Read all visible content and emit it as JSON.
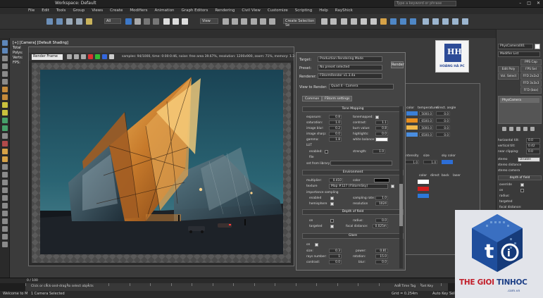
{
  "title_bar": {
    "workspace": "Workspace: Default",
    "search_placeholder": "Type a keyword or phrase"
  },
  "menu": [
    "File",
    "Edit",
    "Tools",
    "Group",
    "Views",
    "Create",
    "Modifiers",
    "Animation",
    "Graph Editors",
    "Rendering",
    "Civil View",
    "Customize",
    "Scripting",
    "Help",
    "RayShick"
  ],
  "toolbar": {
    "selection_dropdown": "All",
    "view_dropdown": "View",
    "named_selection": "Create Selection Se"
  },
  "viewport": {
    "label": "[+] [Camera] [Default Shading]",
    "stats": [
      "Total",
      "Polys:",
      "Verts:",
      "FPS:"
    ]
  },
  "render_window": {
    "title": "Camera001, frame 0, Display Gamma 2.2, RGBA Color 16 Bits/Channel (1:1)",
    "area_dropdown": "Render Frame",
    "stats": "samples: 94/1000,  time: 0:00:0:46,  noise: free area 39.67%,  resolution: 1200x900,  zoom: 71%,  memory: 1.3 MB"
  },
  "render_setup": {
    "target_label": "Target:",
    "target_value": "Production Rendering Mode",
    "preset_label": "Preset:",
    "preset_value": "No preset selected",
    "renderer_label": "Renderer:",
    "renderer_value": "FStormRender v1.3.4a",
    "view_label": "View to Render:",
    "view_value": "Quad 4 - Camera",
    "render_button": "Render",
    "tabs": [
      "Common",
      "FStorm settings"
    ],
    "sections": {
      "tone": "Tone Mapping",
      "env": "Environment",
      "dof": "Depth of field",
      "glare": "Glare"
    },
    "tone_mapping": {
      "exposure": {
        "label": "exposure:",
        "value": "0.8"
      },
      "saturation": {
        "label": "saturation:",
        "value": "1.0"
      },
      "image_blur": {
        "label": "image blur:",
        "value": "0.2"
      },
      "image_sharp": {
        "label": "image sharp:",
        "value": "0.0"
      },
      "gamma": {
        "label": "gamma:",
        "value": "1.8"
      },
      "lut": {
        "label": "LUT"
      },
      "lut_enabled": {
        "label": "enabled:"
      },
      "lut_file": {
        "label": "file"
      },
      "lut_strength": {
        "label": "strength:",
        "value": "1.0"
      },
      "set_from_library": {
        "label": "set from library",
        "value": ""
      },
      "tonemapped": {
        "label": "tonemapped:"
      },
      "contrast": {
        "label": "contrast:",
        "value": "1.1"
      },
      "burn_value": {
        "label": "burn value:",
        "value": "0.8"
      },
      "highlights": {
        "label": "highlights:",
        "value": "0.0"
      },
      "white_balance": {
        "label": "white balance:"
      }
    },
    "environment": {
      "multiplier": {
        "label": "multiplier:",
        "value": "0.410"
      },
      "color": {
        "label": "color"
      },
      "texture": {
        "label": "texture",
        "value": "Map #127 (FStormSky)"
      },
      "importance": {
        "label": "importance sampling"
      },
      "enabled": {
        "label": "enabled"
      },
      "sampling_rate": {
        "label": "sampling rate:",
        "value": "1.0"
      },
      "hemisphere": {
        "label": "hemisphere"
      },
      "resolution": {
        "label": "resolution",
        "value": "1024"
      }
    },
    "depth_of_field": {
      "on": {
        "label": "on"
      },
      "radius": {
        "label": "radius:",
        "value": "0.0"
      },
      "targeted": {
        "label": "targeted"
      },
      "focal_distance": {
        "label": "focal distance:",
        "value": "0.025m"
      }
    },
    "glare": {
      "on": {
        "label": "on"
      },
      "size": {
        "label": "size:",
        "value": "0.3"
      },
      "power": {
        "label": "power:",
        "value": "0.81"
      },
      "rays_number": {
        "label": "rays number:",
        "value": "1"
      },
      "rotation": {
        "label": "rotation:",
        "value": "15.0"
      },
      "contrast": {
        "label": "contrast:",
        "value": "0.0"
      },
      "blur": {
        "label": "blur:",
        "value": "0.0"
      }
    }
  },
  "sky_panel": {
    "headers": [
      "color",
      "temperature",
      "direct. angle"
    ],
    "row_values": [
      [
        "5000.0",
        "0.0"
      ],
      [
        "6500.0",
        "0.0"
      ],
      [
        "5000.0",
        "0.0"
      ],
      [
        "6500.0",
        "0.0"
      ]
    ],
    "labels": [
      "intensity",
      "size",
      "sky color",
      "color",
      "direct",
      "back",
      "laser"
    ],
    "values": [
      "1.0",
      "1.0"
    ]
  },
  "command_panel": {
    "name_field": "PhysCamera001",
    "modifier_list": "Modifier List",
    "buttons": [
      "PPS Cap",
      "Edit Poly",
      "FPS Sel",
      "Vol. Select",
      "FFD 2x2x2",
      "FFD 3x3x3",
      "FFD (box)"
    ],
    "stack_item": "PhysCamera",
    "params": [
      {
        "label": "horizontal tilt:",
        "value": "0.0"
      },
      {
        "label": "vertical tilt:",
        "value": "0.42"
      },
      {
        "label": "near clipping:",
        "value": "0.0"
      }
    ],
    "stereo_label": "stereo",
    "stereo_value": "Disable",
    "stereo_dist": "stereo distance",
    "stereo_cam": "stereo camera",
    "dof_header": "depth of field",
    "dof_items": [
      "override",
      "on",
      "radius:",
      "targeted",
      "focal distance:"
    ]
  },
  "timeline": {
    "frame": "0 / 100"
  },
  "status": {
    "selection": "1 Camera Selected",
    "prompt": "Click or click-and-drag to select objects",
    "grid": "Grid = 0.254m",
    "auto_key": "Auto Key",
    "selected": "Selected",
    "add_time_tag": "Add Time Tag",
    "set_key": "Set Key",
    "maxscript": "Welcome to M"
  },
  "hoangha_logo": {
    "text": "HOÀNG HÀ PC"
  },
  "watermark": {
    "brand_a": "THE GIOI ",
    "brand_b": "TINHOC",
    "site": ".com.vn"
  }
}
